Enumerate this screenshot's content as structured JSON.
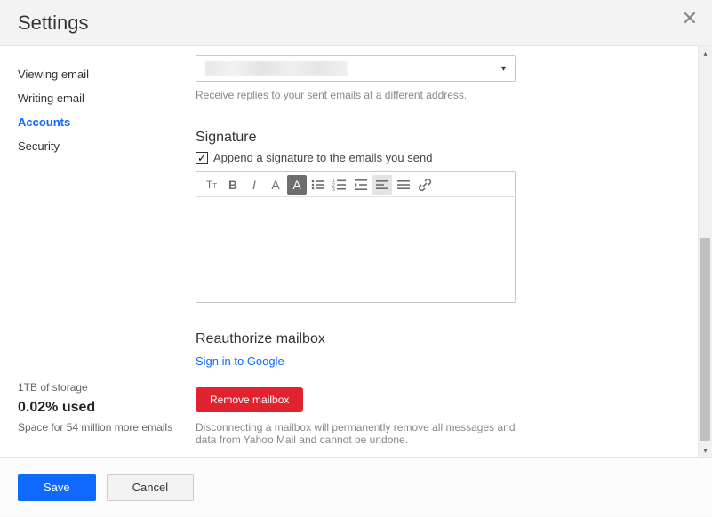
{
  "header": {
    "title": "Settings"
  },
  "sidebar": {
    "items": [
      {
        "label": "Viewing email"
      },
      {
        "label": "Writing email"
      },
      {
        "label": "Accounts"
      },
      {
        "label": "Security"
      }
    ]
  },
  "main": {
    "reply_help": "Receive replies to your sent emails at a different address.",
    "signature_title": "Signature",
    "signature_check_label": "Append a signature to the emails you send",
    "reauth_title": "Reauthorize mailbox",
    "signin_link": "Sign in to Google",
    "remove_label": "Remove mailbox",
    "disconnect_help": "Disconnecting a mailbox will permanently remove all messages and data from Yahoo Mail and cannot be undone."
  },
  "storage": {
    "total": "1TB of storage",
    "used": "0.02% used",
    "space": "Space for 54 million more emails"
  },
  "footer": {
    "save": "Save",
    "cancel": "Cancel"
  }
}
